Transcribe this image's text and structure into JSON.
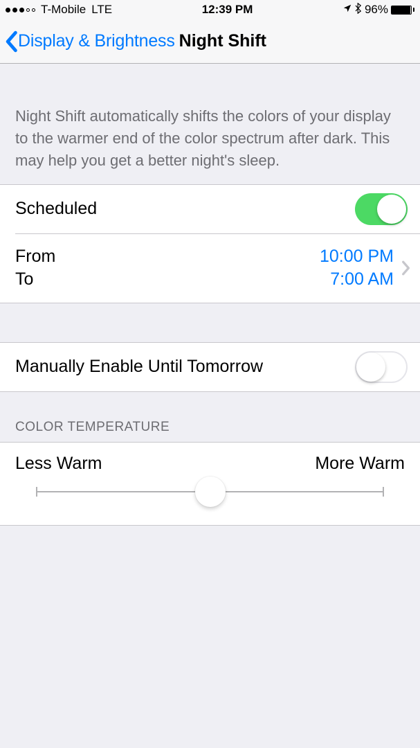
{
  "status": {
    "carrier": "T-Mobile",
    "network": "LTE",
    "time": "12:39 PM",
    "battery_pct": "96%"
  },
  "nav": {
    "back_label": "Display & Brightness",
    "title": "Night Shift"
  },
  "intro": "Night Shift automatically shifts the colors of your display to the warmer end of the color spectrum after dark. This may help you get a better night's sleep.",
  "scheduled": {
    "label": "Scheduled",
    "on": true,
    "from_label": "From",
    "to_label": "To",
    "from_time": "10:00 PM",
    "to_time": "7:00 AM"
  },
  "manual": {
    "label": "Manually Enable Until Tomorrow",
    "on": false
  },
  "temperature": {
    "header": "COLOR TEMPERATURE",
    "less": "Less Warm",
    "more": "More Warm"
  }
}
